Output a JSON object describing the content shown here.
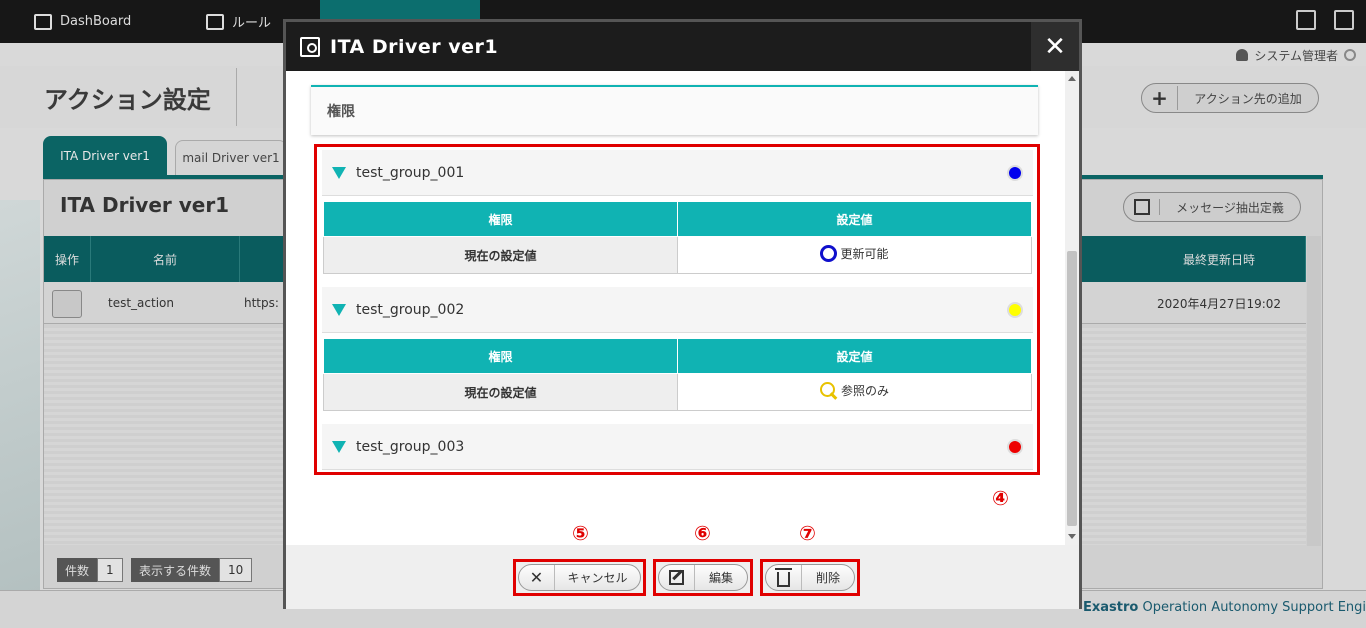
{
  "app": {
    "nav": [
      {
        "label": "DashBoard"
      },
      {
        "label": "ルール"
      },
      {
        "label": ""
      },
      {
        "label": ""
      }
    ],
    "user": "システム管理者",
    "page_title": "アクション設定",
    "add_dest_label": "アクション先の追加",
    "tabs": [
      "ITA Driver ver1",
      "mail Driver ver1"
    ],
    "panel_title": "ITA Driver ver1",
    "msg_button_label": "メッセージ抽出定義",
    "table": {
      "headers": {
        "ops": "操作",
        "name": "名前",
        "updated": "最終更新日時"
      },
      "row": {
        "name": "test_action",
        "url": "https:",
        "updated": "2020年4月27日19:02"
      }
    },
    "pager": {
      "count_label": "件数",
      "count": "1",
      "per_page_label": "表示する件数",
      "per_page": "10"
    },
    "footer_bold": "Exastro",
    "footer_rest": " Operation Autonomy Support Engine"
  },
  "modal": {
    "title": "ITA Driver ver1",
    "close_label": "✕",
    "section_title": "権限",
    "table_headers": {
      "perm": "権限",
      "value": "設定値"
    },
    "row_label": "現在の設定値",
    "groups": [
      {
        "name": "test_group_001",
        "dot_color": "#0000ee",
        "value": "更新可能",
        "value_icon": "circle-icon"
      },
      {
        "name": "test_group_002",
        "dot_color": "#ffff00",
        "value": "参照のみ",
        "value_icon": "magnifier-icon"
      },
      {
        "name": "test_group_003",
        "dot_color": "#ee0000"
      }
    ],
    "callouts": [
      "④",
      "⑤",
      "⑥",
      "⑦"
    ],
    "buttons": {
      "cancel": "キャンセル",
      "edit": "編集",
      "delete": "削除"
    }
  },
  "colors": {
    "accent": "#10b3b3",
    "highlight": "#e00000",
    "header": "#1c1c1c"
  }
}
